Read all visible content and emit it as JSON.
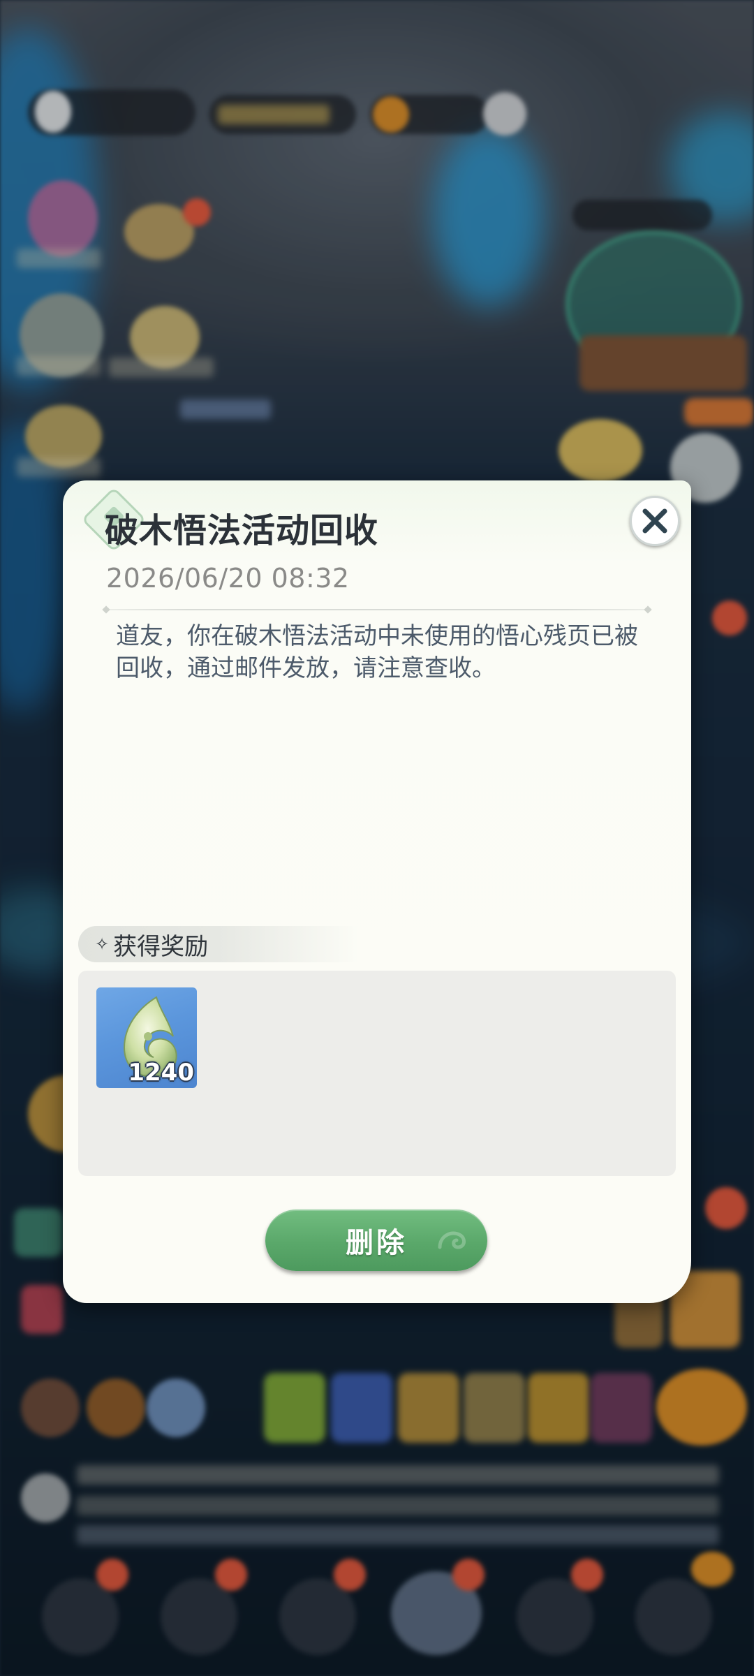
{
  "mail": {
    "title": "破木悟法活动回收",
    "date": "2026/06/20 08:32",
    "body": "道友，你在破木悟法活动中未使用的悟心残页已被回收，通过邮件发放，请注意查收。"
  },
  "reward": {
    "header": "获得奖励",
    "sparkle_icon": "✧",
    "items": [
      {
        "icon": "jade-pendant-icon",
        "quantity": "1240"
      }
    ]
  },
  "actions": {
    "delete_label": "删除",
    "close_icon": "close-icon"
  },
  "colors": {
    "delete_button": "#5aa86a",
    "dialog_bg": "#fcfcf6",
    "item_bg": "#5b96dc"
  }
}
